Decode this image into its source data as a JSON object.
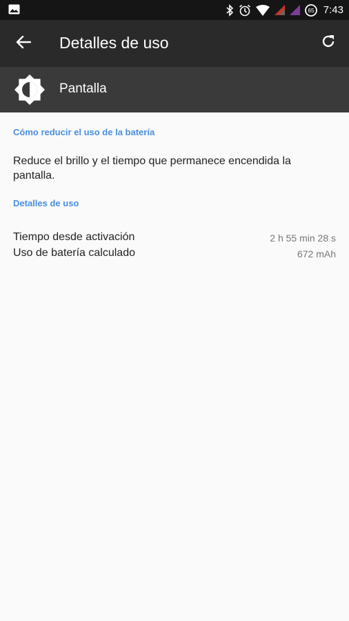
{
  "status_bar": {
    "time": "7:43",
    "battery_level": "65",
    "icons": [
      "image-icon",
      "bluetooth-icon",
      "alarm-icon",
      "wifi-icon",
      "signal-icon",
      "signal-icon-2",
      "battery-icon"
    ]
  },
  "app_bar": {
    "title": "Detalles de uso",
    "back_icon": "arrow-back-icon",
    "refresh_icon": "refresh-icon"
  },
  "header": {
    "label": "Pantalla",
    "icon": "brightness-icon"
  },
  "tips": {
    "section_title": "Cómo reducir el uso de la batería",
    "text": "Reduce el brillo y el tiempo que permanece encendida la pantalla."
  },
  "usage": {
    "section_title": "Detalles de uso",
    "rows": [
      {
        "label": "Tiempo desde activación",
        "value": "2 h 55 min 28 s"
      },
      {
        "label": "Uso de batería calculado",
        "value": "672 mAh"
      }
    ]
  },
  "colors": {
    "status_bar": "#151515",
    "app_bar": "#2a2a2a",
    "header_band": "#3a3a3a",
    "accent": "#4a8ee0",
    "background": "#fafafa"
  }
}
